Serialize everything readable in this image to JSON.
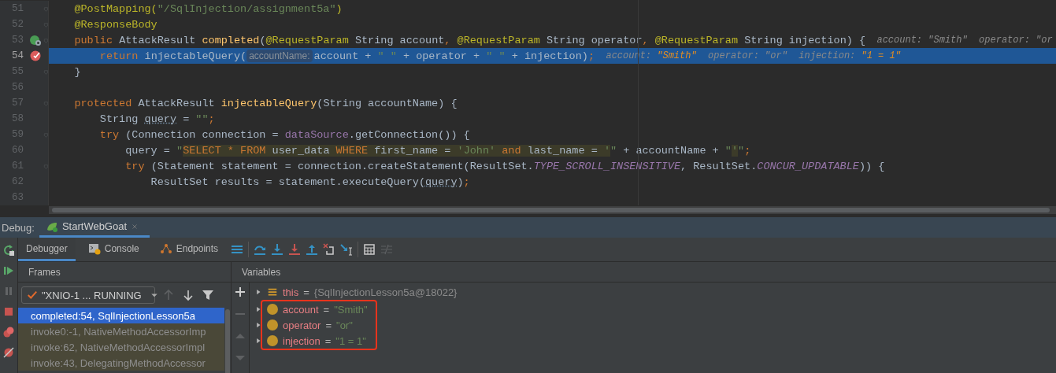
{
  "editor": {
    "lines": [
      {
        "number": "51",
        "current": false,
        "fold": true,
        "breakpoint": false,
        "overrides": false,
        "tokens": [
          {
            "kind": "ann",
            "text": "    @PostMapping("
          },
          {
            "kind": "str",
            "text": "\"/SqlInjection/assignment5a\""
          },
          {
            "kind": "ann",
            "text": ")"
          }
        ]
      },
      {
        "number": "52",
        "current": false,
        "fold": true,
        "breakpoint": false,
        "overrides": false,
        "tokens": [
          {
            "kind": "ann",
            "text": "    @ResponseBody"
          }
        ]
      },
      {
        "number": "53",
        "current": false,
        "fold": true,
        "breakpoint": false,
        "overrides": true,
        "tokens": [
          {
            "kind": "kw",
            "text": "    public "
          },
          {
            "kind": "plain",
            "text": "AttackResult "
          },
          {
            "kind": "meth",
            "text": "completed"
          },
          {
            "kind": "plain",
            "text": "("
          },
          {
            "kind": "ann",
            "text": "@RequestParam"
          },
          {
            "kind": "plain",
            "text": " String account"
          },
          {
            "kind": "kw",
            "text": ", "
          },
          {
            "kind": "ann",
            "text": "@RequestParam"
          },
          {
            "kind": "plain",
            "text": " String operator"
          },
          {
            "kind": "kw",
            "text": ", "
          },
          {
            "kind": "ann",
            "text": "@RequestParam"
          },
          {
            "kind": "plain",
            "text": " String injection) {"
          },
          {
            "kind": "hint",
            "text": "  account: \"Smith\"  operator: \"or"
          }
        ]
      },
      {
        "number": "54",
        "current": true,
        "fold": false,
        "breakpoint": true,
        "overrides": false,
        "tokens": [
          {
            "kind": "kw",
            "text": "        return "
          },
          {
            "kind": "plain",
            "text": "injectableQuery("
          },
          {
            "kind": "param",
            "text": "accountName:"
          },
          {
            "kind": "plain",
            "text": "account + "
          },
          {
            "kind": "str",
            "text": "\" \""
          },
          {
            "kind": "plain",
            "text": " + operator + "
          },
          {
            "kind": "str",
            "text": "\" \""
          },
          {
            "kind": "plain",
            "text": " + injection)"
          },
          {
            "kind": "kw",
            "text": ";"
          },
          {
            "kind": "hint",
            "text": "  account: "
          },
          {
            "kind": "hintval",
            "text": "\"Smith\""
          },
          {
            "kind": "hint",
            "text": "  operator: \"or\"  injection: "
          },
          {
            "kind": "hintval",
            "text": "\"1 = 1\""
          }
        ]
      },
      {
        "number": "55",
        "current": false,
        "fold": true,
        "breakpoint": false,
        "overrides": false,
        "tokens": [
          {
            "kind": "plain",
            "text": "    }"
          }
        ]
      },
      {
        "number": "56",
        "current": false,
        "fold": false,
        "breakpoint": false,
        "overrides": false
      },
      {
        "number": "57",
        "current": false,
        "fold": true,
        "breakpoint": false,
        "overrides": false,
        "tokens": [
          {
            "kind": "kw",
            "text": "    protected "
          },
          {
            "kind": "plain",
            "text": "AttackResult "
          },
          {
            "kind": "meth",
            "text": "injectableQuery"
          },
          {
            "kind": "plain",
            "text": "(String accountName) {"
          }
        ]
      },
      {
        "number": "58",
        "current": false,
        "fold": false,
        "breakpoint": false,
        "overrides": false,
        "tokens": [
          {
            "kind": "plain",
            "text": "        String "
          },
          {
            "kind": "var",
            "text": "query"
          },
          {
            "kind": "plain",
            "text": " = "
          },
          {
            "kind": "str",
            "text": "\"\""
          },
          {
            "kind": "kw",
            "text": ";"
          }
        ]
      },
      {
        "number": "59",
        "current": false,
        "fold": true,
        "breakpoint": false,
        "overrides": false,
        "tokens": [
          {
            "kind": "kw",
            "text": "        try "
          },
          {
            "kind": "plain",
            "text": "(Connection connection = "
          },
          {
            "kind": "field",
            "text": "dataSource"
          },
          {
            "kind": "plain",
            "text": ".getConnection()) {"
          }
        ]
      },
      {
        "number": "60",
        "current": false,
        "fold": false,
        "breakpoint": false,
        "overrides": false,
        "tokens": [
          {
            "kind": "plain",
            "text": "            query = "
          },
          {
            "kind": "str",
            "text": "\""
          },
          {
            "kind": "sqlkw",
            "text": "SELECT * FROM"
          },
          {
            "kind": "sql",
            "text": " user_data "
          },
          {
            "kind": "sqlkw",
            "text": "WHERE"
          },
          {
            "kind": "sql",
            "text": " first_name = "
          },
          {
            "kind": "sqlstr",
            "text": "'John'"
          },
          {
            "kind": "sqlkw",
            "text": " and"
          },
          {
            "kind": "sql",
            "text": " last_name = "
          },
          {
            "kind": "sqlstr",
            "text": "'"
          },
          {
            "kind": "str",
            "text": "\""
          },
          {
            "kind": "plain",
            "text": " + accountName + "
          },
          {
            "kind": "str",
            "text": "\""
          },
          {
            "kind": "sqlstr",
            "text": "'"
          },
          {
            "kind": "str",
            "text": "\""
          },
          {
            "kind": "kw",
            "text": ";"
          }
        ]
      },
      {
        "number": "61",
        "current": false,
        "fold": true,
        "breakpoint": false,
        "overrides": false,
        "tokens": [
          {
            "kind": "kw",
            "text": "            try "
          },
          {
            "kind": "plain",
            "text": "(Statement statement = connection.createStatement(ResultSet."
          },
          {
            "kind": "static",
            "text": "TYPE_SCROLL_INSENSITIVE"
          },
          {
            "kind": "plain",
            "text": ", ResultSet."
          },
          {
            "kind": "static",
            "text": "CONCUR_UPDATABLE"
          },
          {
            "kind": "plain",
            "text": ")) {"
          }
        ]
      },
      {
        "number": "62",
        "current": false,
        "fold": false,
        "breakpoint": false,
        "overrides": false,
        "tokens": [
          {
            "kind": "plain",
            "text": "                ResultSet results = statement.executeQuery("
          },
          {
            "kind": "var",
            "text": "query"
          },
          {
            "kind": "plain",
            "text": ")"
          },
          {
            "kind": "kw",
            "text": ";"
          }
        ]
      },
      {
        "number": "63",
        "current": false,
        "fold": false,
        "breakpoint": false,
        "overrides": false
      }
    ]
  },
  "debug": {
    "label": "Debug:",
    "session": "StartWebGoat",
    "tabs": [
      {
        "label": "Debugger",
        "selected": true
      },
      {
        "label": "Console",
        "selected": false
      },
      {
        "label": "Endpoints",
        "selected": false
      }
    ],
    "frames": {
      "title": "Frames",
      "thread": "\"XNIO-1 ... RUNNING",
      "items": [
        {
          "text": "completed:54, SqlInjectionLesson5a",
          "selected": true
        },
        {
          "text": "invoke0:-1, NativeMethodAccessorImp",
          "selected": false
        },
        {
          "text": "invoke:62, NativeMethodAccessorImpl",
          "selected": false
        },
        {
          "text": "invoke:43, DelegatingMethodAccessor",
          "selected": false
        }
      ]
    },
    "variables": {
      "title": "Variables",
      "items": [
        {
          "kind": "object",
          "name": "this",
          "separator": "=",
          "value": "{SqlInjectionLesson5a@18022}",
          "boxed": false
        },
        {
          "kind": "param",
          "name": "account",
          "separator": "=",
          "value": "\"Smith\"",
          "boxed": true
        },
        {
          "kind": "param",
          "name": "operator",
          "separator": "=",
          "value": "\"or\"",
          "boxed": true
        },
        {
          "kind": "param",
          "name": "injection",
          "separator": "=",
          "value": "\"1 = 1\"",
          "boxed": true
        }
      ]
    }
  }
}
